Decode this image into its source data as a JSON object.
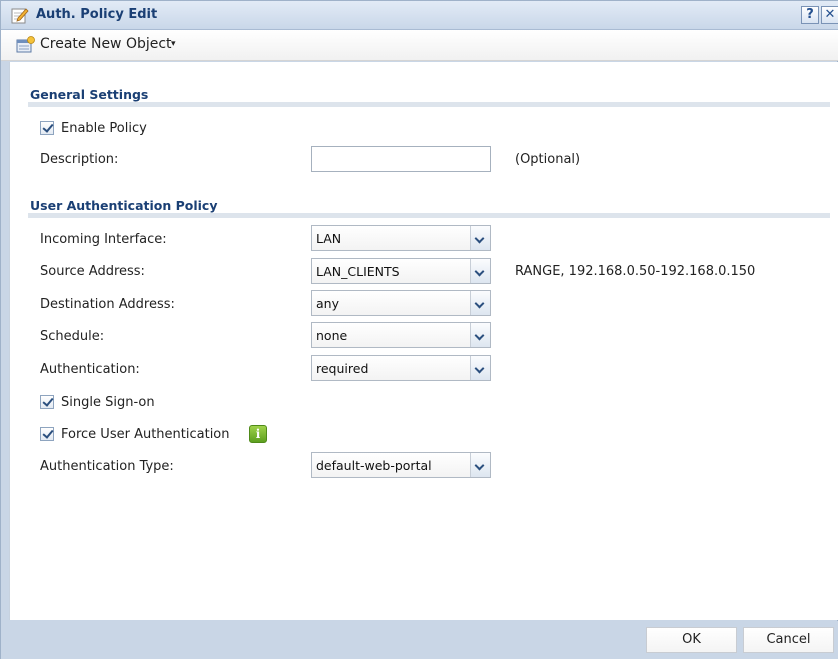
{
  "window": {
    "title": "Auth. Policy Edit",
    "help_label": "?",
    "close_label": "✕"
  },
  "toolbar": {
    "create_label": "Create New Object",
    "create_caret": "▾"
  },
  "general": {
    "section_title": "General Settings",
    "enable_policy_label": "Enable Policy",
    "enable_policy_checked": true,
    "description_label": "Description:",
    "description_value": "",
    "description_hint": "(Optional)"
  },
  "uap": {
    "section_title": "User Authentication Policy",
    "incoming_interface": {
      "label": "Incoming Interface:",
      "value": "LAN"
    },
    "source_address": {
      "label": "Source Address:",
      "value": "LAN_CLIENTS",
      "hint": "RANGE, 192.168.0.50-192.168.0.150"
    },
    "destination_address": {
      "label": "Destination Address:",
      "value": "any"
    },
    "schedule": {
      "label": "Schedule:",
      "value": "none"
    },
    "authentication": {
      "label": "Authentication:",
      "value": "required"
    },
    "single_sign_on": {
      "label": "Single Sign-on",
      "checked": true
    },
    "force_user_auth": {
      "label": "Force User Authentication",
      "checked": true,
      "info_icon": "i"
    },
    "authentication_type": {
      "label": "Authentication Type:",
      "value": "default-web-portal"
    }
  },
  "footer": {
    "ok_label": "OK",
    "cancel_label": "Cancel"
  },
  "icons": {
    "title": "edit-pencil-icon",
    "create": "create-object-icon",
    "info": "info-icon",
    "dropdown": "chevron-down-icon"
  },
  "colors": {
    "title_text": "#1a3f74",
    "frame": "#c9d6e6",
    "info_green": "#6fb02a"
  }
}
